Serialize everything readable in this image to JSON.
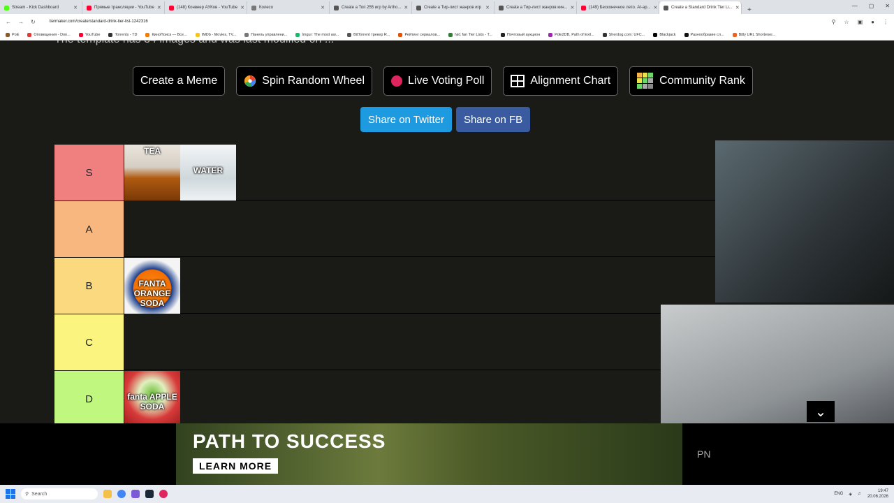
{
  "browser": {
    "tabs": [
      {
        "label": "Stream - Kick Dashboard",
        "color": "#53fc18"
      },
      {
        "label": "Прямые трансляции - YouTube",
        "color": "#ff0033"
      },
      {
        "label": "(148) Конвеер АУКов - YouTube",
        "color": "#ff0033"
      },
      {
        "label": "Колесо",
        "color": "#777777"
      },
      {
        "label": "Create a Топ 255 игр by Artho...",
        "color": "#555555"
      },
      {
        "label": "Create a Тир-лист жанров игр",
        "color": "#555555"
      },
      {
        "label": "Create a Тир-лист жанров кин...",
        "color": "#555555"
      },
      {
        "label": "(149) Бесконечное лето. AI-ар...",
        "color": "#ff0033"
      },
      {
        "label": "Create a Standard Drink Tier Li...",
        "color": "#555555"
      }
    ],
    "new_tab": "+",
    "url": "tiermaker.com/create/standard-drink-tier-list-1242316",
    "bookmarks": [
      "PoE",
      "Оповещения - Don...",
      "YouTube",
      "Torrents - TD",
      "КиноПоиск — Все...",
      "IMDb - Movies, TV...",
      "Панель управлени...",
      "Imgur: The most aw...",
      "BitTorrent трекер R...",
      "Рейтинг сериалов...",
      "№1 fan Tier Lists - T...",
      "Почтовый аукцион",
      "PoE2DB, Path of Exil...",
      "Sherdog.com: UFC...",
      "Blackjack",
      "Разнообразие сл...",
      "Bitly URL Shortener..."
    ]
  },
  "page": {
    "cut_text": "The template has 34 images and was last modified on ...",
    "buttons": [
      {
        "label": "Create a Meme",
        "icon": ""
      },
      {
        "label": "Spin Random Wheel",
        "icon": "wheel-icon"
      },
      {
        "label": "Live Voting Poll",
        "icon": "poll-dot-icon"
      },
      {
        "label": "Alignment Chart",
        "icon": "grid-icon"
      },
      {
        "label": "Community Rank",
        "icon": "rank-grid-icon"
      }
    ],
    "share_twitter": "Share on Twitter",
    "share_fb": "Share on FB"
  },
  "tiers": [
    {
      "label": "S",
      "color": "#f08080",
      "items": [
        {
          "caption": "TEA"
        },
        {
          "caption": "WATER"
        }
      ]
    },
    {
      "label": "A",
      "color": "#f7b77e",
      "items": []
    },
    {
      "label": "B",
      "color": "#fad97f",
      "items": [
        {
          "caption": "FANTA ORANGE SODA"
        }
      ]
    },
    {
      "label": "C",
      "color": "#fbf57f",
      "items": []
    },
    {
      "label": "D",
      "color": "#bff77f",
      "items": [
        {
          "caption": "fanta APPLE SODA"
        }
      ]
    }
  ],
  "ad": {
    "title": "PATH TO SUCCESS",
    "button": "LEARN MORE",
    "brand": "PN"
  },
  "taskbar": {
    "search": "Search",
    "lang": "ENG",
    "time": "19:47",
    "date": "20.06.2026"
  }
}
